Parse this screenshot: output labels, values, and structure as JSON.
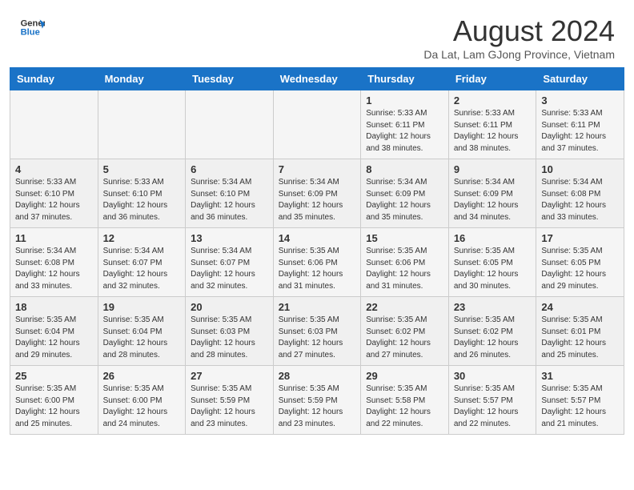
{
  "header": {
    "logo_line1": "General",
    "logo_line2": "Blue",
    "month": "August 2024",
    "location": "Da Lat, Lam GJong Province, Vietnam"
  },
  "days_of_week": [
    "Sunday",
    "Monday",
    "Tuesday",
    "Wednesday",
    "Thursday",
    "Friday",
    "Saturday"
  ],
  "weeks": [
    [
      {
        "day": "",
        "info": ""
      },
      {
        "day": "",
        "info": ""
      },
      {
        "day": "",
        "info": ""
      },
      {
        "day": "",
        "info": ""
      },
      {
        "day": "1",
        "info": "Sunrise: 5:33 AM\nSunset: 6:11 PM\nDaylight: 12 hours\nand 38 minutes."
      },
      {
        "day": "2",
        "info": "Sunrise: 5:33 AM\nSunset: 6:11 PM\nDaylight: 12 hours\nand 38 minutes."
      },
      {
        "day": "3",
        "info": "Sunrise: 5:33 AM\nSunset: 6:11 PM\nDaylight: 12 hours\nand 37 minutes."
      }
    ],
    [
      {
        "day": "4",
        "info": "Sunrise: 5:33 AM\nSunset: 6:10 PM\nDaylight: 12 hours\nand 37 minutes."
      },
      {
        "day": "5",
        "info": "Sunrise: 5:33 AM\nSunset: 6:10 PM\nDaylight: 12 hours\nand 36 minutes."
      },
      {
        "day": "6",
        "info": "Sunrise: 5:34 AM\nSunset: 6:10 PM\nDaylight: 12 hours\nand 36 minutes."
      },
      {
        "day": "7",
        "info": "Sunrise: 5:34 AM\nSunset: 6:09 PM\nDaylight: 12 hours\nand 35 minutes."
      },
      {
        "day": "8",
        "info": "Sunrise: 5:34 AM\nSunset: 6:09 PM\nDaylight: 12 hours\nand 35 minutes."
      },
      {
        "day": "9",
        "info": "Sunrise: 5:34 AM\nSunset: 6:09 PM\nDaylight: 12 hours\nand 34 minutes."
      },
      {
        "day": "10",
        "info": "Sunrise: 5:34 AM\nSunset: 6:08 PM\nDaylight: 12 hours\nand 33 minutes."
      }
    ],
    [
      {
        "day": "11",
        "info": "Sunrise: 5:34 AM\nSunset: 6:08 PM\nDaylight: 12 hours\nand 33 minutes."
      },
      {
        "day": "12",
        "info": "Sunrise: 5:34 AM\nSunset: 6:07 PM\nDaylight: 12 hours\nand 32 minutes."
      },
      {
        "day": "13",
        "info": "Sunrise: 5:34 AM\nSunset: 6:07 PM\nDaylight: 12 hours\nand 32 minutes."
      },
      {
        "day": "14",
        "info": "Sunrise: 5:35 AM\nSunset: 6:06 PM\nDaylight: 12 hours\nand 31 minutes."
      },
      {
        "day": "15",
        "info": "Sunrise: 5:35 AM\nSunset: 6:06 PM\nDaylight: 12 hours\nand 31 minutes."
      },
      {
        "day": "16",
        "info": "Sunrise: 5:35 AM\nSunset: 6:05 PM\nDaylight: 12 hours\nand 30 minutes."
      },
      {
        "day": "17",
        "info": "Sunrise: 5:35 AM\nSunset: 6:05 PM\nDaylight: 12 hours\nand 29 minutes."
      }
    ],
    [
      {
        "day": "18",
        "info": "Sunrise: 5:35 AM\nSunset: 6:04 PM\nDaylight: 12 hours\nand 29 minutes."
      },
      {
        "day": "19",
        "info": "Sunrise: 5:35 AM\nSunset: 6:04 PM\nDaylight: 12 hours\nand 28 minutes."
      },
      {
        "day": "20",
        "info": "Sunrise: 5:35 AM\nSunset: 6:03 PM\nDaylight: 12 hours\nand 28 minutes."
      },
      {
        "day": "21",
        "info": "Sunrise: 5:35 AM\nSunset: 6:03 PM\nDaylight: 12 hours\nand 27 minutes."
      },
      {
        "day": "22",
        "info": "Sunrise: 5:35 AM\nSunset: 6:02 PM\nDaylight: 12 hours\nand 27 minutes."
      },
      {
        "day": "23",
        "info": "Sunrise: 5:35 AM\nSunset: 6:02 PM\nDaylight: 12 hours\nand 26 minutes."
      },
      {
        "day": "24",
        "info": "Sunrise: 5:35 AM\nSunset: 6:01 PM\nDaylight: 12 hours\nand 25 minutes."
      }
    ],
    [
      {
        "day": "25",
        "info": "Sunrise: 5:35 AM\nSunset: 6:00 PM\nDaylight: 12 hours\nand 25 minutes."
      },
      {
        "day": "26",
        "info": "Sunrise: 5:35 AM\nSunset: 6:00 PM\nDaylight: 12 hours\nand 24 minutes."
      },
      {
        "day": "27",
        "info": "Sunrise: 5:35 AM\nSunset: 5:59 PM\nDaylight: 12 hours\nand 23 minutes."
      },
      {
        "day": "28",
        "info": "Sunrise: 5:35 AM\nSunset: 5:59 PM\nDaylight: 12 hours\nand 23 minutes."
      },
      {
        "day": "29",
        "info": "Sunrise: 5:35 AM\nSunset: 5:58 PM\nDaylight: 12 hours\nand 22 minutes."
      },
      {
        "day": "30",
        "info": "Sunrise: 5:35 AM\nSunset: 5:57 PM\nDaylight: 12 hours\nand 22 minutes."
      },
      {
        "day": "31",
        "info": "Sunrise: 5:35 AM\nSunset: 5:57 PM\nDaylight: 12 hours\nand 21 minutes."
      }
    ]
  ]
}
